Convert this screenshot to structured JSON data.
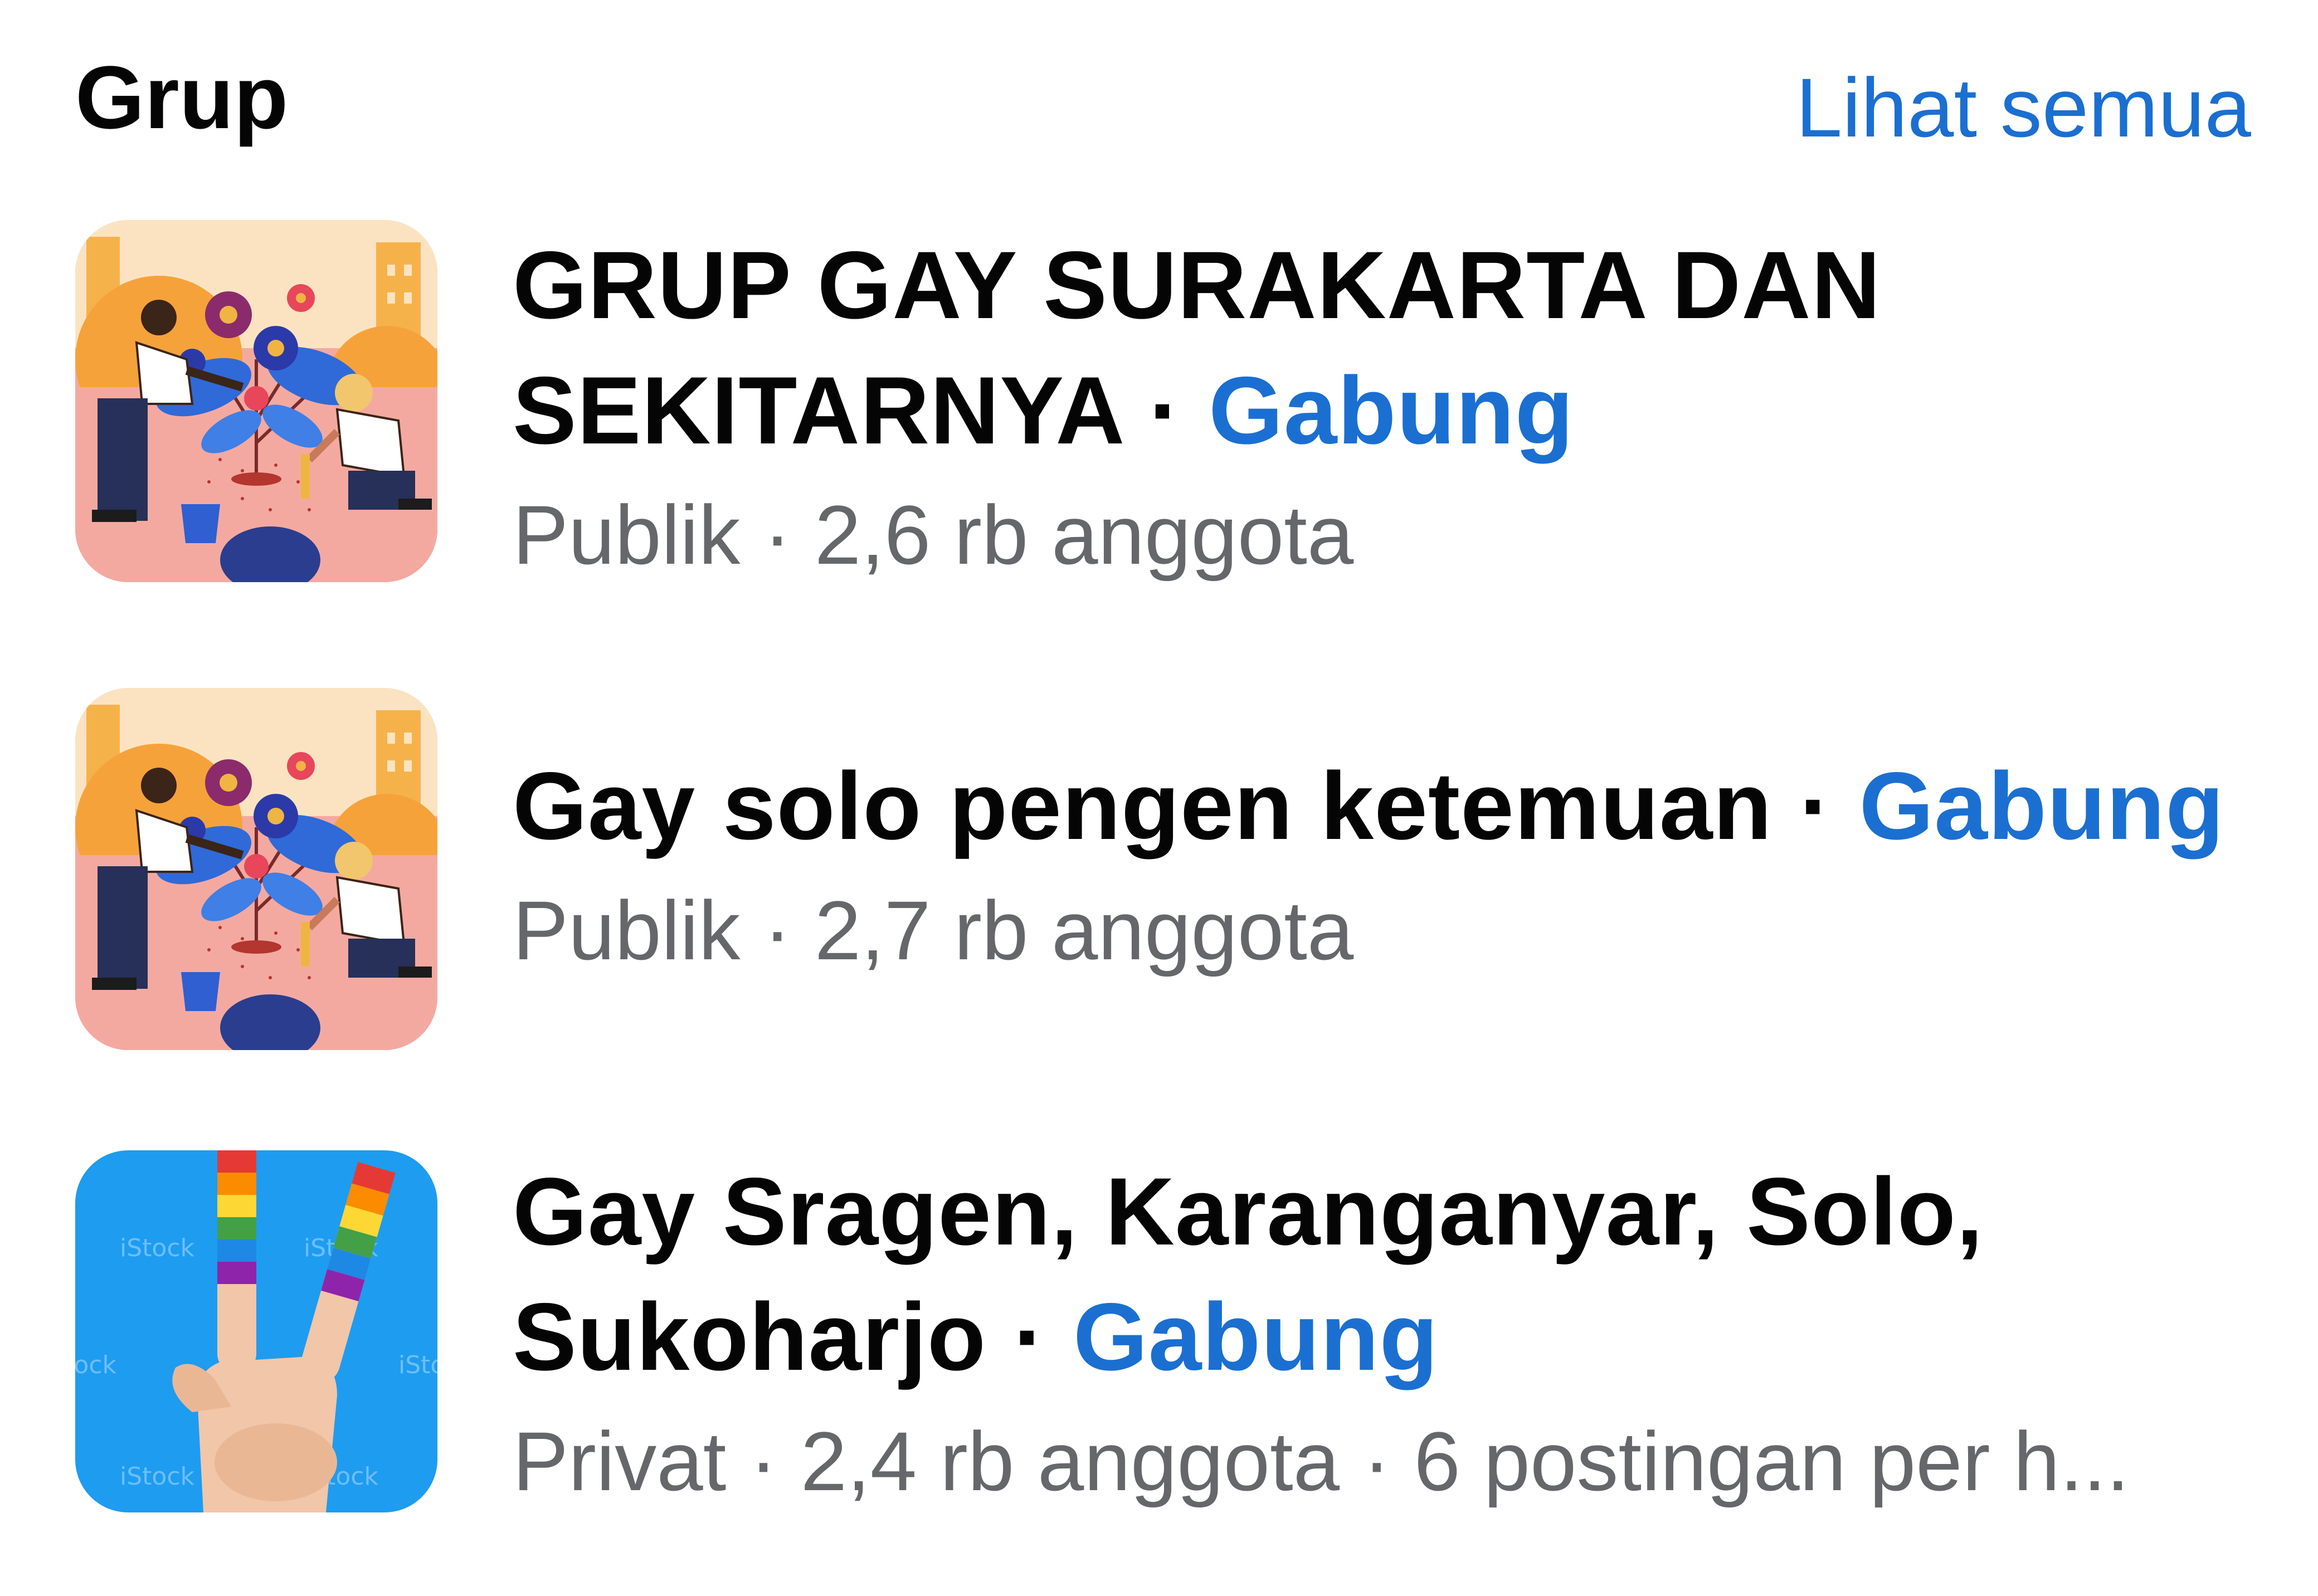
{
  "header": {
    "title": "Grup",
    "see_all_label": "Lihat semua"
  },
  "colors": {
    "accent": "#1b6fd1",
    "text_primary": "#050505",
    "text_secondary": "#65676b"
  },
  "groups": [
    {
      "name_line1": "GRUP GAY SURAKARTA DAN",
      "name_line2": "SEKITARNYA",
      "separator": " · ",
      "join_label": "Gabung",
      "privacy": "Publik",
      "meta_sep": " · ",
      "members": "2,6 rb anggota",
      "thumbnail_icon": "garden-illustration-icon"
    },
    {
      "name_line1": "Gay solo pengen ketemuan",
      "separator": " · ",
      "join_label": "Gabung",
      "privacy": "Publik",
      "meta_sep": " · ",
      "members": "2,7 rb anggota",
      "thumbnail_icon": "garden-illustration-icon"
    },
    {
      "name_line1": "Gay Sragen, Karanganyar, Solo,",
      "name_line2": "Sukoharjo",
      "separator": " · ",
      "join_label": "Gabung",
      "meta": "Privat · 2,4 rb anggota · 6 postingan per h...",
      "thumbnail_icon": "rainbow-peace-hand-icon",
      "watermark": "iStock"
    }
  ]
}
